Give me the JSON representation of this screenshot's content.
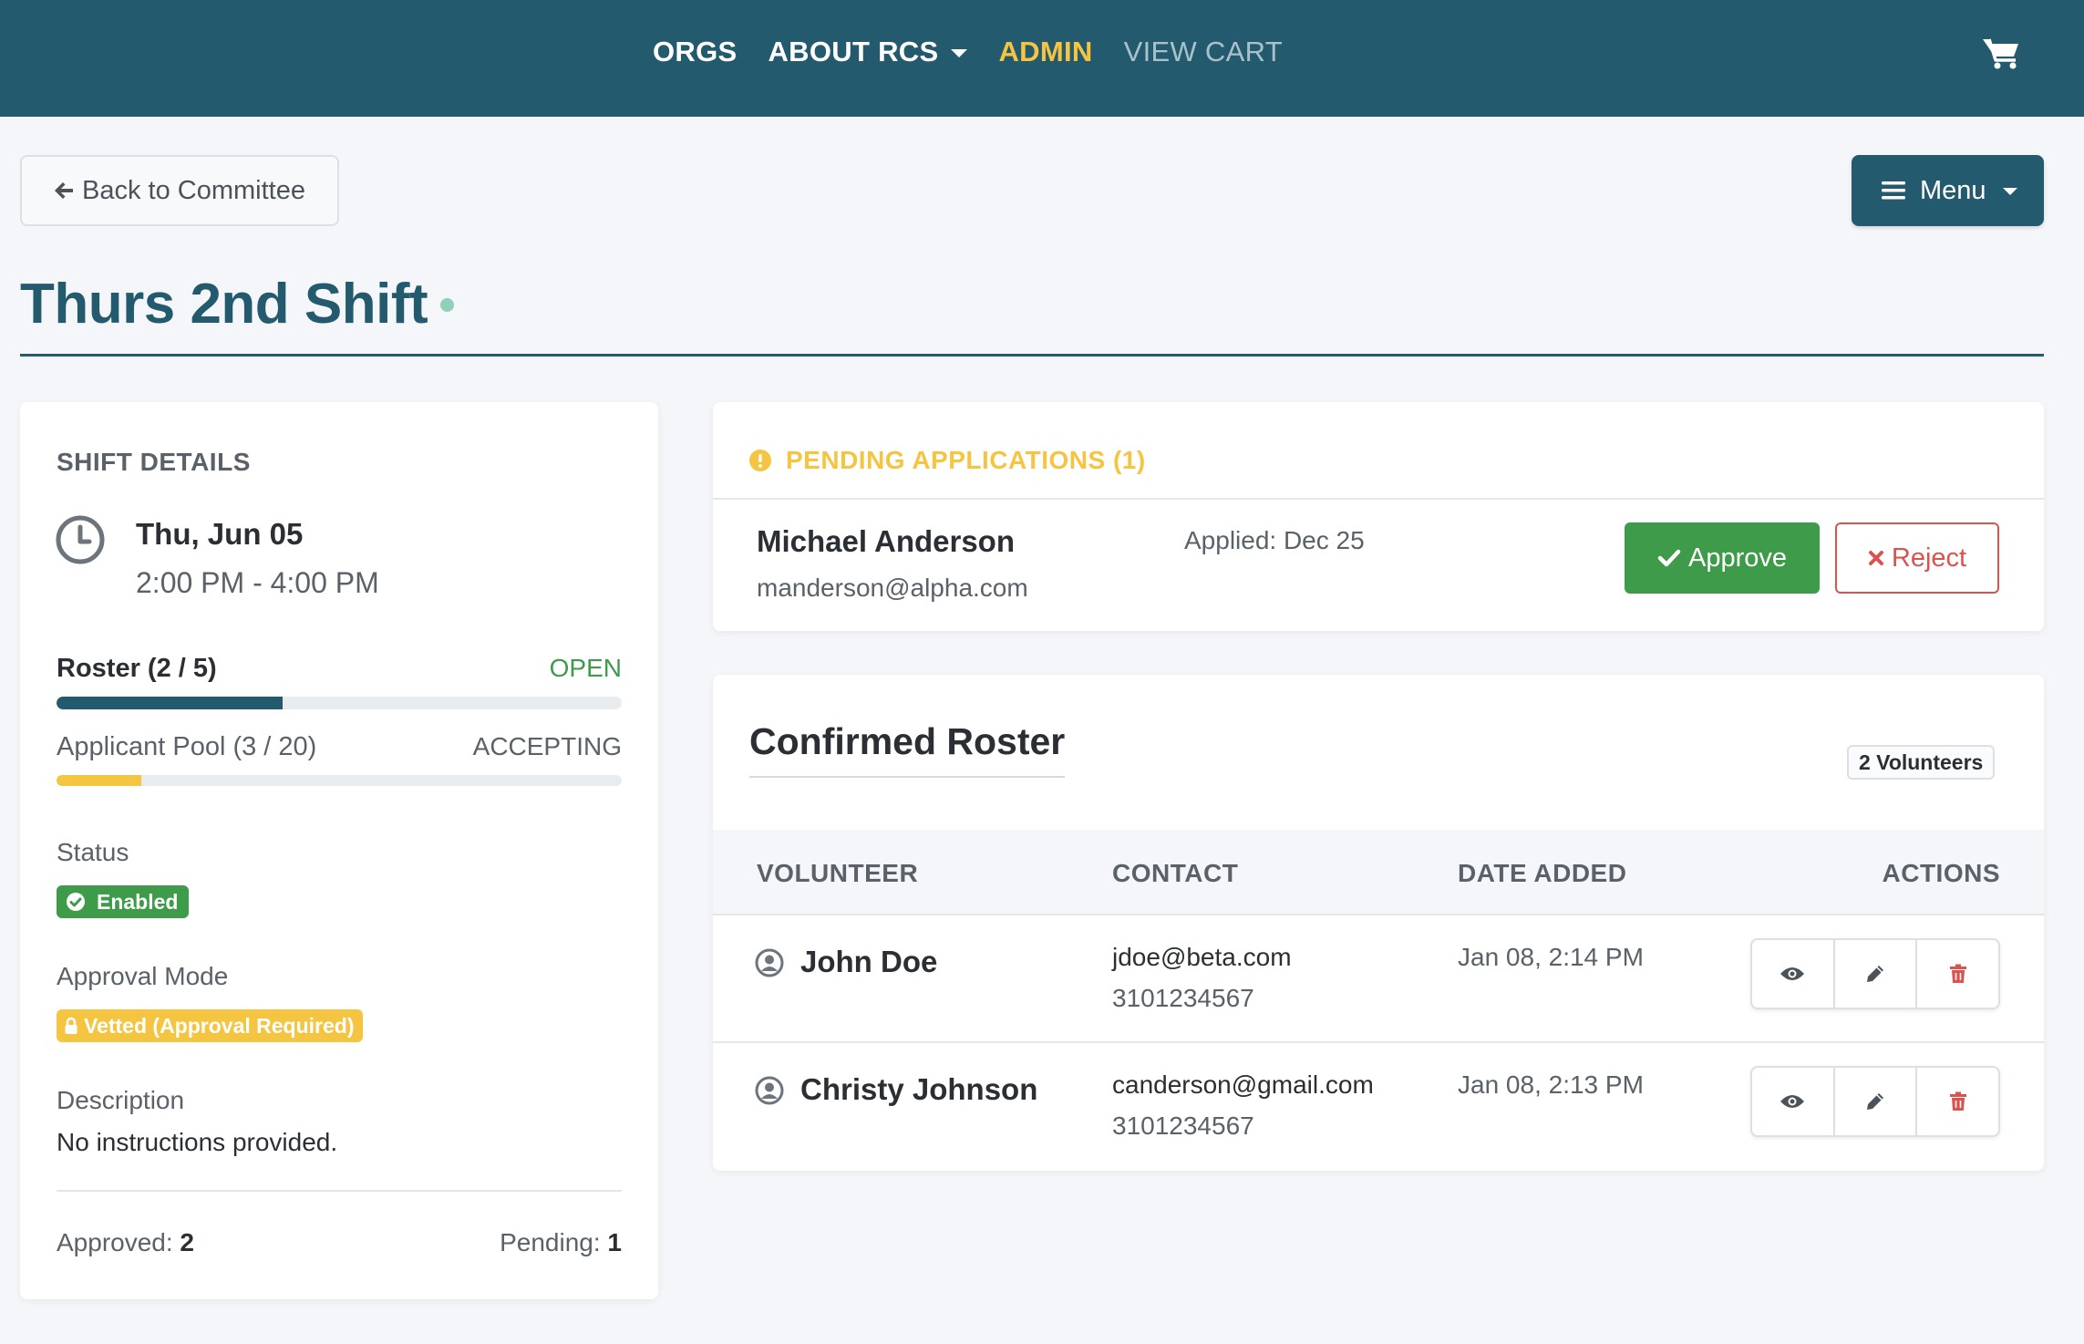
{
  "nav": {
    "links": [
      {
        "label": "ORGS"
      },
      {
        "label": "ABOUT RCS"
      },
      {
        "label": "ADMIN"
      },
      {
        "label": "VIEW CART"
      }
    ],
    "cart_icon": "shopping-cart-icon"
  },
  "toolbar": {
    "back_label": "Back to Committee",
    "menu_label": "Menu"
  },
  "page": {
    "title": "Thurs 2nd Shift"
  },
  "shift_details": {
    "heading": "SHIFT DETAILS",
    "date": "Thu, Jun 05",
    "time": "2:00 PM - 4:00 PM",
    "roster": {
      "label": "Roster (2 / 5)",
      "status": "OPEN",
      "fill": 0.4
    },
    "pool": {
      "label": "Applicant Pool (3 / 20)",
      "status": "ACCEPTING",
      "fill": 0.15
    },
    "status_label": "Status",
    "status_value": "Enabled",
    "approval_label": "Approval Mode",
    "approval_value": "Vetted (Approval Required)",
    "description_label": "Description",
    "description_value": "No instructions provided.",
    "approved_label": "Approved:",
    "approved_value": "2",
    "pending_label": "Pending:",
    "pending_value": "1"
  },
  "pending": {
    "heading": "PENDING APPLICATIONS (1)",
    "applicant": {
      "name": "Michael Anderson",
      "email": "manderson@alpha.com",
      "applied": "Applied: Dec 25"
    },
    "approve_label": "Approve",
    "reject_label": "Reject"
  },
  "roster": {
    "title": "Confirmed Roster",
    "count_badge": "2 Volunteers",
    "columns": [
      "VOLUNTEER",
      "CONTACT",
      "DATE ADDED",
      "ACTIONS"
    ],
    "rows": [
      {
        "name": "John Doe",
        "email": "jdoe@beta.com",
        "phone": "3101234567",
        "date": "Jan 08, 2:14 PM"
      },
      {
        "name": "Christy Johnson",
        "email": "canderson@gmail.com",
        "phone": "3101234567",
        "date": "Jan 08, 2:13 PM"
      }
    ]
  },
  "colors": {
    "brand": "#245a6e",
    "accent_yellow": "#f5c542",
    "success": "#3e9b4a",
    "danger": "#d9534f"
  }
}
